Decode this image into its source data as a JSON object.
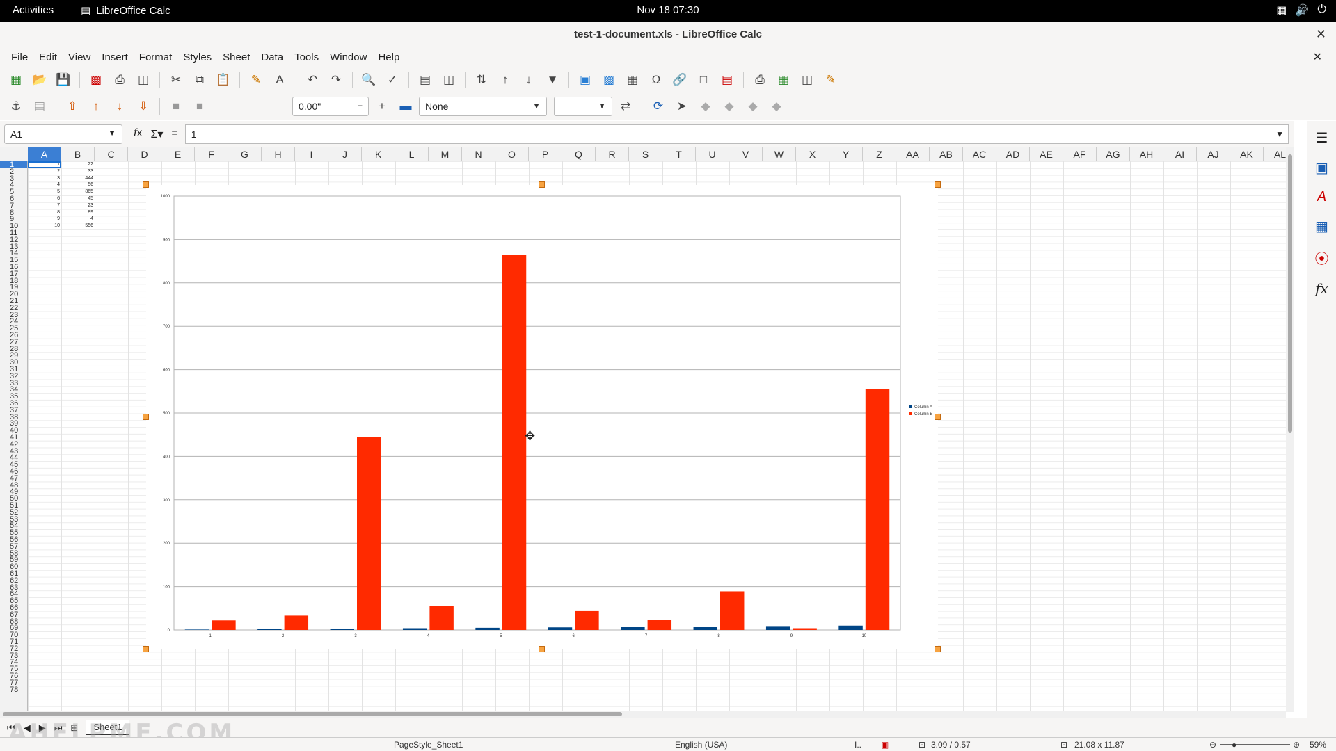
{
  "topbar": {
    "activities": "Activities",
    "app_name": "LibreOffice Calc",
    "clock": "Nov 18  07:30"
  },
  "window": {
    "title": "test-1-document.xls - LibreOffice Calc"
  },
  "menu": [
    "File",
    "Edit",
    "View",
    "Insert",
    "Format",
    "Styles",
    "Sheet",
    "Data",
    "Tools",
    "Window",
    "Help"
  ],
  "toolbar2": {
    "width_value": "0.00\"",
    "line_style": "None"
  },
  "formula": {
    "name_box": "A1",
    "content": "1"
  },
  "columns": [
    "A",
    "B",
    "C",
    "D",
    "E",
    "F",
    "G",
    "H",
    "I",
    "J",
    "K",
    "L",
    "M",
    "N",
    "O",
    "P",
    "Q",
    "R",
    "S",
    "T",
    "U",
    "V",
    "W",
    "X",
    "Y",
    "Z",
    "AA",
    "AB",
    "AC",
    "AD",
    "AE",
    "AF",
    "AG",
    "AH",
    "AI",
    "AJ",
    "AK",
    "AL"
  ],
  "row_count": 78,
  "cells": {
    "A": [
      1,
      2,
      3,
      4,
      5,
      6,
      7,
      8,
      9,
      10
    ],
    "B": [
      22,
      33,
      444,
      56,
      865,
      45,
      23,
      89,
      4,
      556
    ]
  },
  "chart_data": {
    "type": "bar",
    "categories": [
      "1",
      "2",
      "3",
      "4",
      "5",
      "6",
      "7",
      "8",
      "9",
      "10"
    ],
    "series": [
      {
        "name": "Column A",
        "values": [
          1,
          2,
          3,
          4,
          5,
          6,
          7,
          8,
          9,
          10
        ],
        "color": "#004586"
      },
      {
        "name": "Column B",
        "values": [
          22,
          33,
          444,
          56,
          865,
          45,
          23,
          89,
          4,
          556
        ],
        "color": "#ff2a00"
      }
    ],
    "ylim": [
      0,
      1000
    ],
    "yticks": [
      0,
      100,
      200,
      300,
      400,
      500,
      600,
      700,
      800,
      900,
      1000
    ],
    "grid": true,
    "legend_position": "right"
  },
  "sheet_tabs": [
    "Sheet1"
  ],
  "watermark": "AHELPME.COM",
  "status": {
    "page_style": "PageStyle_Sheet1",
    "language": "English (USA)",
    "position": "3.09 / 0.57",
    "size": "21.08 x 11.87",
    "zoom": "59%"
  }
}
